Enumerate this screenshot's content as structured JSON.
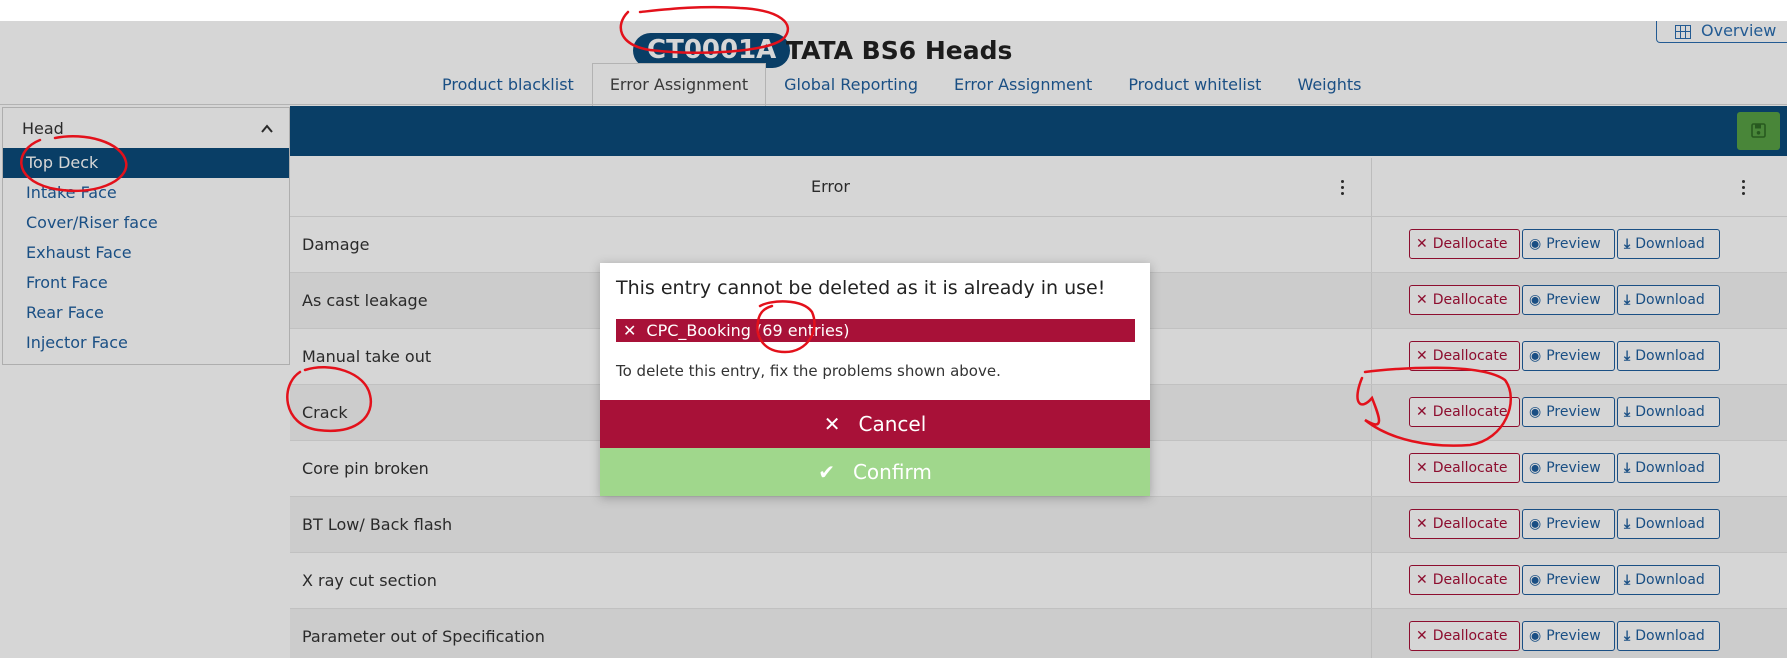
{
  "header": {
    "code_badge": "CT0001A",
    "title": "TATA BS6 Heads",
    "overview_label": "Overview",
    "overview_icon": "grid-icon"
  },
  "tabs": [
    {
      "label": "Product blacklist",
      "active": false
    },
    {
      "label": "Error Assignment",
      "active": true
    },
    {
      "label": "Global Reporting",
      "active": false
    },
    {
      "label": "Error Assignment",
      "active": false
    },
    {
      "label": "Product whitelist",
      "active": false
    },
    {
      "label": "Weights",
      "active": false
    }
  ],
  "sidebar": {
    "heading": "Head",
    "heading_icon": "chevron-up-icon",
    "items": [
      {
        "label": "Top Deck",
        "active": true
      },
      {
        "label": "Intake Face",
        "active": false
      },
      {
        "label": "Cover/Riser face",
        "active": false
      },
      {
        "label": "Exhaust Face",
        "active": false
      },
      {
        "label": "Front Face",
        "active": false
      },
      {
        "label": "Rear Face",
        "active": false
      },
      {
        "label": "Injector Face",
        "active": false
      }
    ]
  },
  "toolbar": {
    "save_icon": "save-icon"
  },
  "table": {
    "column_error": "Error",
    "rows": [
      {
        "label": "Damage"
      },
      {
        "label": "As cast leakage"
      },
      {
        "label": "Manual take out"
      },
      {
        "label": "Crack"
      },
      {
        "label": "Core pin broken"
      },
      {
        "label": "BT Low/ Back flash"
      },
      {
        "label": "X ray cut section"
      },
      {
        "label": "Parameter out of Specification"
      }
    ],
    "actions": {
      "deallocate": "Deallocate",
      "preview": "Preview",
      "download": "Download"
    }
  },
  "modal": {
    "message": "This entry cannot be deleted as it is already in use!",
    "error_item": "CPC_Booking (69 entries)",
    "hint": "To delete this entry, fix the problems shown above.",
    "cancel_label": "Cancel",
    "confirm_label": "Confirm"
  },
  "colors": {
    "primary": "#0b4a7a",
    "danger": "#a81138",
    "confirm": "#a0d78c",
    "save": "#58a044",
    "link": "#1f5f9e",
    "annotation": "#e3111b"
  }
}
